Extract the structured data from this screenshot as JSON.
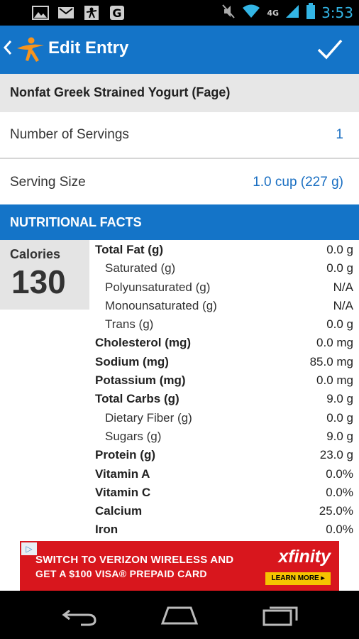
{
  "status_bar": {
    "time": "3:53",
    "network": "4G",
    "icons": [
      "image-icon",
      "gmail-icon",
      "myfitnesspal-icon",
      "google-icon",
      "mute-icon",
      "wifi-icon",
      "signal-icon",
      "battery-icon"
    ],
    "time_color": "#33b5e5"
  },
  "action_bar": {
    "title": "Edit Entry",
    "back_icon": "chevron-left-icon",
    "logo_icon": "myfitnesspal-logo-icon",
    "confirm_icon": "check-icon",
    "color": "#1474c8"
  },
  "food": {
    "name": "Nonfat Greek Strained Yogurt (Fage)"
  },
  "servings": {
    "label": "Number of Servings",
    "value": "1"
  },
  "serving_size": {
    "label": "Serving Size",
    "value": "1.0 cup (227 g)"
  },
  "section": {
    "title": "NUTRITIONAL FACTS"
  },
  "calories": {
    "label": "Calories",
    "value": "130"
  },
  "nutrients": [
    {
      "label": "Total Fat (g)",
      "value": "0.0 g",
      "style": "bold"
    },
    {
      "label": "Saturated (g)",
      "value": "0.0 g",
      "style": "sub"
    },
    {
      "label": "Polyunsaturated (g)",
      "value": "N/A",
      "style": "sub"
    },
    {
      "label": "Monounsaturated (g)",
      "value": "N/A",
      "style": "sub"
    },
    {
      "label": "Trans (g)",
      "value": "0.0 g",
      "style": "sub"
    },
    {
      "label": "Cholesterol (mg)",
      "value": "0.0 mg",
      "style": "bold"
    },
    {
      "label": "Sodium (mg)",
      "value": "85.0 mg",
      "style": "bold"
    },
    {
      "label": "Potassium (mg)",
      "value": "0.0 mg",
      "style": "bold"
    },
    {
      "label": "Total Carbs (g)",
      "value": "9.0 g",
      "style": "bold"
    },
    {
      "label": "Dietary Fiber (g)",
      "value": "0.0 g",
      "style": "sub"
    },
    {
      "label": "Sugars (g)",
      "value": "9.0 g",
      "style": "sub"
    },
    {
      "label": "Protein (g)",
      "value": "23.0 g",
      "style": "bold"
    },
    {
      "label": "Vitamin A",
      "value": "0.0%",
      "style": "bold"
    },
    {
      "label": "Vitamin C",
      "value": "0.0%",
      "style": "bold"
    },
    {
      "label": "Calcium",
      "value": "25.0%",
      "style": "bold"
    },
    {
      "label": "Iron",
      "value": "0.0%",
      "style": "bold"
    }
  ],
  "ad": {
    "line1": "SWITCH TO VERIZON WIRELESS AND",
    "line2": "GET A $100 VISA® PREPAID CARD",
    "brand": "xfinity",
    "cta": "LEARN MORE ▸",
    "background": "#d8161d"
  },
  "nav_bar": {
    "icons": [
      "back-icon",
      "home-icon",
      "recent-apps-icon"
    ]
  }
}
